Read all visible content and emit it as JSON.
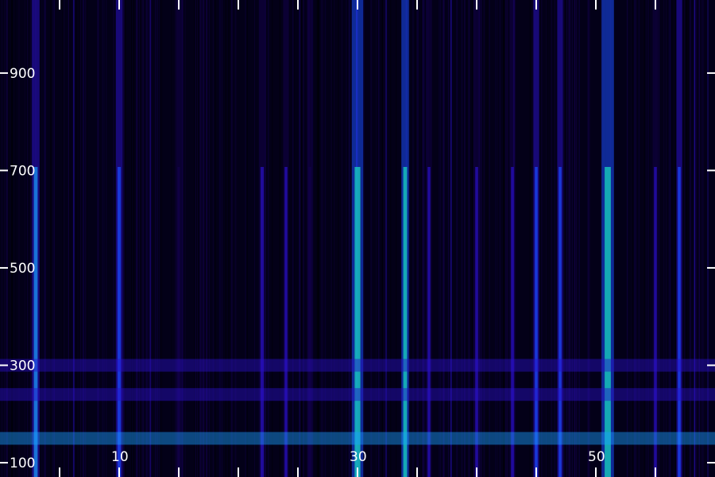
{
  "chart_data": {
    "type": "heatmap",
    "title": "",
    "xlabel": "",
    "ylabel": "",
    "y_ticks": [
      "100",
      "300",
      "500",
      "700",
      "900"
    ],
    "x_tick_labels": [
      "10",
      "30",
      "50"
    ],
    "ylim": [
      100,
      1000
    ],
    "grid": false,
    "colormap": [
      "#000000",
      "#12004a",
      "#2a10c8",
      "#1a4cff",
      "#1aa0ff",
      "#18e0c0",
      "#6cff4a",
      "#d8ff30"
    ],
    "columns": [
      {
        "x": 3,
        "intensity": 0.75,
        "width": 0.8
      },
      {
        "x": 10,
        "intensity": 0.6,
        "width": 0.7
      },
      {
        "x": 15,
        "intensity": 0.3,
        "width": 0.5
      },
      {
        "x": 22,
        "intensity": 0.4,
        "width": 0.7
      },
      {
        "x": 24,
        "intensity": 0.35,
        "width": 0.6
      },
      {
        "x": 26,
        "intensity": 0.3,
        "width": 0.6
      },
      {
        "x": 30,
        "intensity": 0.95,
        "width": 1.2
      },
      {
        "x": 34,
        "intensity": 0.9,
        "width": 0.8
      },
      {
        "x": 36,
        "intensity": 0.5,
        "width": 0.6
      },
      {
        "x": 40,
        "intensity": 0.5,
        "width": 0.6
      },
      {
        "x": 43,
        "intensity": 0.45,
        "width": 0.6
      },
      {
        "x": 45,
        "intensity": 0.55,
        "width": 0.6
      },
      {
        "x": 47,
        "intensity": 0.6,
        "width": 0.6
      },
      {
        "x": 51,
        "intensity": 1.0,
        "width": 1.3
      },
      {
        "x": 55,
        "intensity": 0.45,
        "width": 0.6
      },
      {
        "x": 57,
        "intensity": 0.55,
        "width": 0.6
      }
    ],
    "bands": [
      {
        "y": 300,
        "intensity": 0.6
      },
      {
        "y": 240,
        "intensity": 0.5
      },
      {
        "y": 150,
        "intensity": 0.85
      }
    ]
  }
}
